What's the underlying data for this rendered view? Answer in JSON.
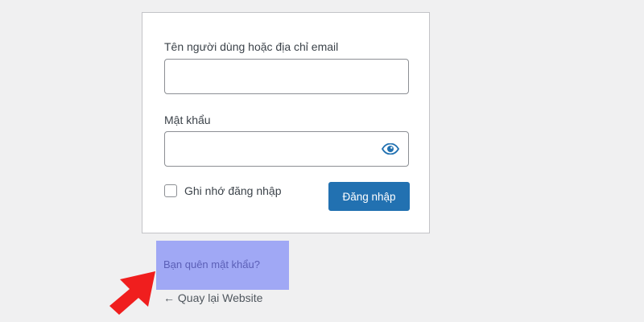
{
  "login_form": {
    "username_label": "Tên người dùng hoặc địa chỉ email",
    "username_value": "",
    "password_label": "Mật khẩu",
    "password_value": "",
    "remember_label": "Ghi nhớ đăng nhập",
    "remember_checked": false,
    "submit_label": "Đăng nhập",
    "password_toggle_icon": "eye-icon"
  },
  "links": {
    "forgot_password": "Bạn quên mật khẩu?",
    "back_to_site": "← Quay lại Website"
  },
  "annotation": {
    "pointer_icon": "red-arrow-icon",
    "highlight_color": "#a0a8f5",
    "arrow_color": "#f01e1e"
  },
  "colors": {
    "background": "#f0f0f1",
    "card": "#ffffff",
    "primary_button": "#2271b1",
    "eye_icon": "#2271b1",
    "forgot_link": "#5b5fb7"
  }
}
